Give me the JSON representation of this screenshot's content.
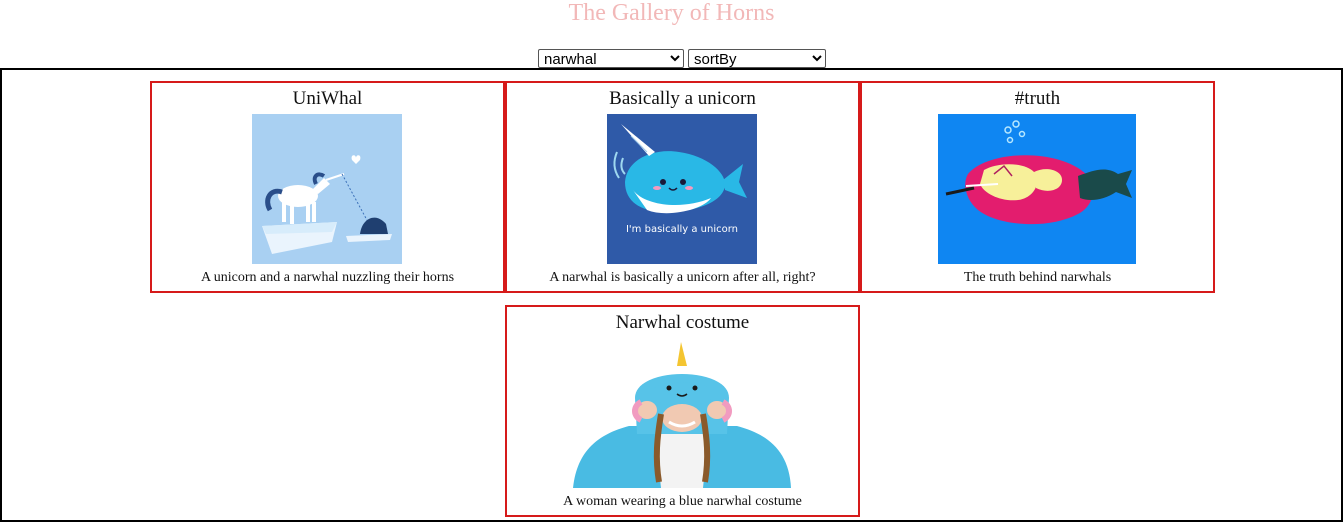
{
  "page": {
    "title": "The Gallery of Horns"
  },
  "filters": {
    "keyword_selected": "narwhal",
    "sort_selected": "sortBy"
  },
  "cards": [
    {
      "title": "UniWhal",
      "description": "A unicorn and a narwhal nuzzling their horns",
      "image_alt": "unicorn and narwhal illustration"
    },
    {
      "title": "Basically a unicorn",
      "description": "A narwhal is basically a unicorn after all, right?",
      "image_text": "I'm basically a unicorn",
      "image_alt": "cartoon narwhal"
    },
    {
      "title": "#truth",
      "description": "The truth behind narwhals",
      "image_alt": "narwhal with unicorn inside"
    },
    {
      "title": "Narwhal costume",
      "description": "A woman wearing a blue narwhal costume",
      "image_alt": "woman in narwhal costume"
    }
  ],
  "colors": {
    "title": "#f2b8b8",
    "card_border": "#d61a1a",
    "gallery_border": "#000000"
  }
}
